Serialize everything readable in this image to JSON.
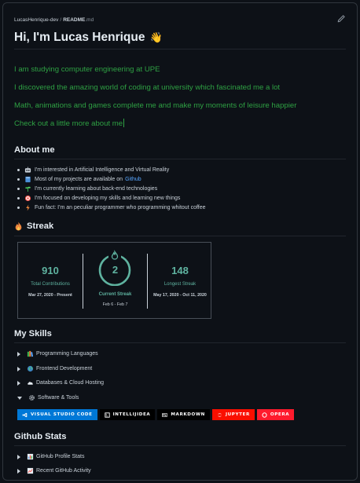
{
  "filebar": {
    "user": "LucasHenrique-dev",
    "file": "README",
    "ext": ".md"
  },
  "title": {
    "text": "Hi, I'm Lucas Henrique",
    "emoji": "👋"
  },
  "intro": [
    "I am studying computer engineering at UPE",
    "I discovered the amazing world of coding at university which fascinated me a lot",
    "Math, animations and games complete me and make my moments of leisure happier",
    "Check out a little more about me"
  ],
  "about": {
    "heading": "About me",
    "items": [
      {
        "icon": "robot-icon",
        "text": "I'm interested in Artificial Intelligence and Virtual Reality"
      },
      {
        "icon": "book-icon",
        "text": "Most of my projects are available on",
        "link": "Github"
      },
      {
        "icon": "seedling-icon",
        "text": "I'm currently learning about back-end technologies"
      },
      {
        "icon": "target-icon",
        "text": "I'm focused on developing my skills and learning new things"
      },
      {
        "icon": "lightning-icon",
        "text": "Fun fact: I'm an peculiar programmer who programming whitout coffee"
      }
    ]
  },
  "streak": {
    "heading": "Streak",
    "total": {
      "value": "910",
      "label": "Total Contributions",
      "range": "Mar 27, 2020 - Present"
    },
    "current": {
      "value": "2",
      "label": "Current Streak",
      "range": "Feb 6 - Feb 7"
    },
    "longest": {
      "value": "148",
      "label": "Longest Streak",
      "range": "May 17, 2020 - Oct 11, 2020"
    },
    "accent": "#5fb3a0"
  },
  "skills": {
    "heading": "My Skills",
    "items": [
      {
        "label": "Programming Languages",
        "icon": "books-icon",
        "open": false
      },
      {
        "label": "Frontend Development",
        "icon": "globe-icon",
        "open": false
      },
      {
        "label": "Databases & Cloud Hosting",
        "icon": "cloud-icon",
        "open": false
      },
      {
        "label": "Software & Tools",
        "icon": "gear-icon",
        "open": true
      }
    ],
    "badges": [
      {
        "label": "VISUAL STUDIO CODE",
        "color": "#0078d7"
      },
      {
        "label": "INTELLIJIDEA",
        "color": "#000000"
      },
      {
        "label": "MARKDOWN",
        "color": "#000000"
      },
      {
        "label": "JUPYTER",
        "color": "#fa0f00"
      },
      {
        "label": "OPERA",
        "color": "#ff1b2d"
      }
    ]
  },
  "stats": {
    "heading": "Github Stats",
    "items": [
      {
        "label": "GitHub Profile Stats",
        "icon": "chart-icon"
      },
      {
        "label": "Recent GitHub Activity",
        "icon": "trend-icon"
      }
    ]
  }
}
